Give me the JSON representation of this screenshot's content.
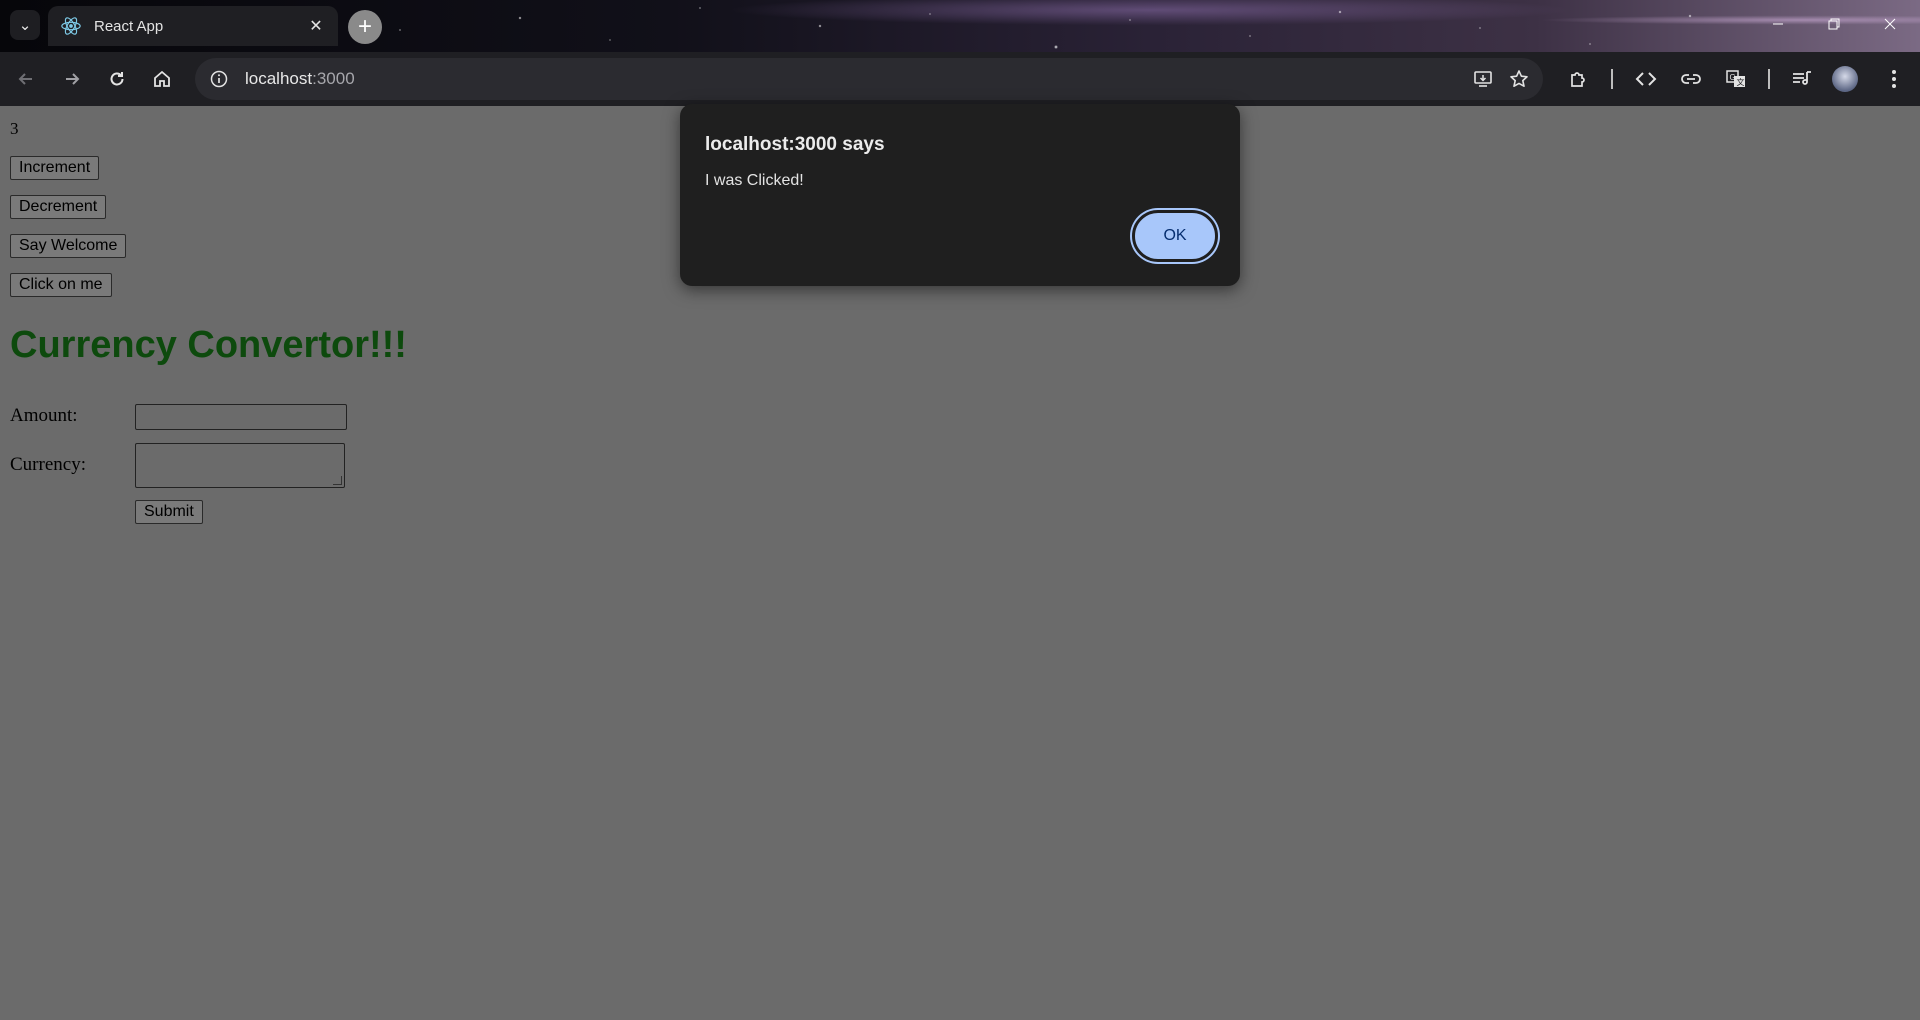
{
  "browser": {
    "tab_title": "React App",
    "url_host": "localhost",
    "url_port": ":3000",
    "accent": "#a8c7fa"
  },
  "page": {
    "counter_value": "3",
    "buttons": {
      "increment": "Increment",
      "decrement": "Decrement",
      "say_welcome": "Say Welcome",
      "click_on_me": "Click on me"
    },
    "heading": "Currency Convertor!!!",
    "heading_color": "#0d4a0d",
    "form": {
      "amount_label": "Amount:",
      "amount_value": "",
      "currency_label": "Currency:",
      "currency_value": "",
      "submit_label": "Submit"
    }
  },
  "alert": {
    "title": "localhost:3000 says",
    "message": "I was Clicked!",
    "ok_label": "OK"
  },
  "icons": [
    "tab-list-icon",
    "react-logo-icon",
    "close-icon",
    "plus-icon",
    "minimize-icon",
    "restore-icon",
    "window-close-icon",
    "back-arrow-icon",
    "forward-arrow-icon",
    "reload-icon",
    "home-icon",
    "site-info-icon",
    "install-app-icon",
    "bookmark-star-icon",
    "extensions-icon",
    "code-icon",
    "link-icon",
    "translate-icon",
    "media-control-icon",
    "profile-avatar",
    "more-menu-icon"
  ]
}
